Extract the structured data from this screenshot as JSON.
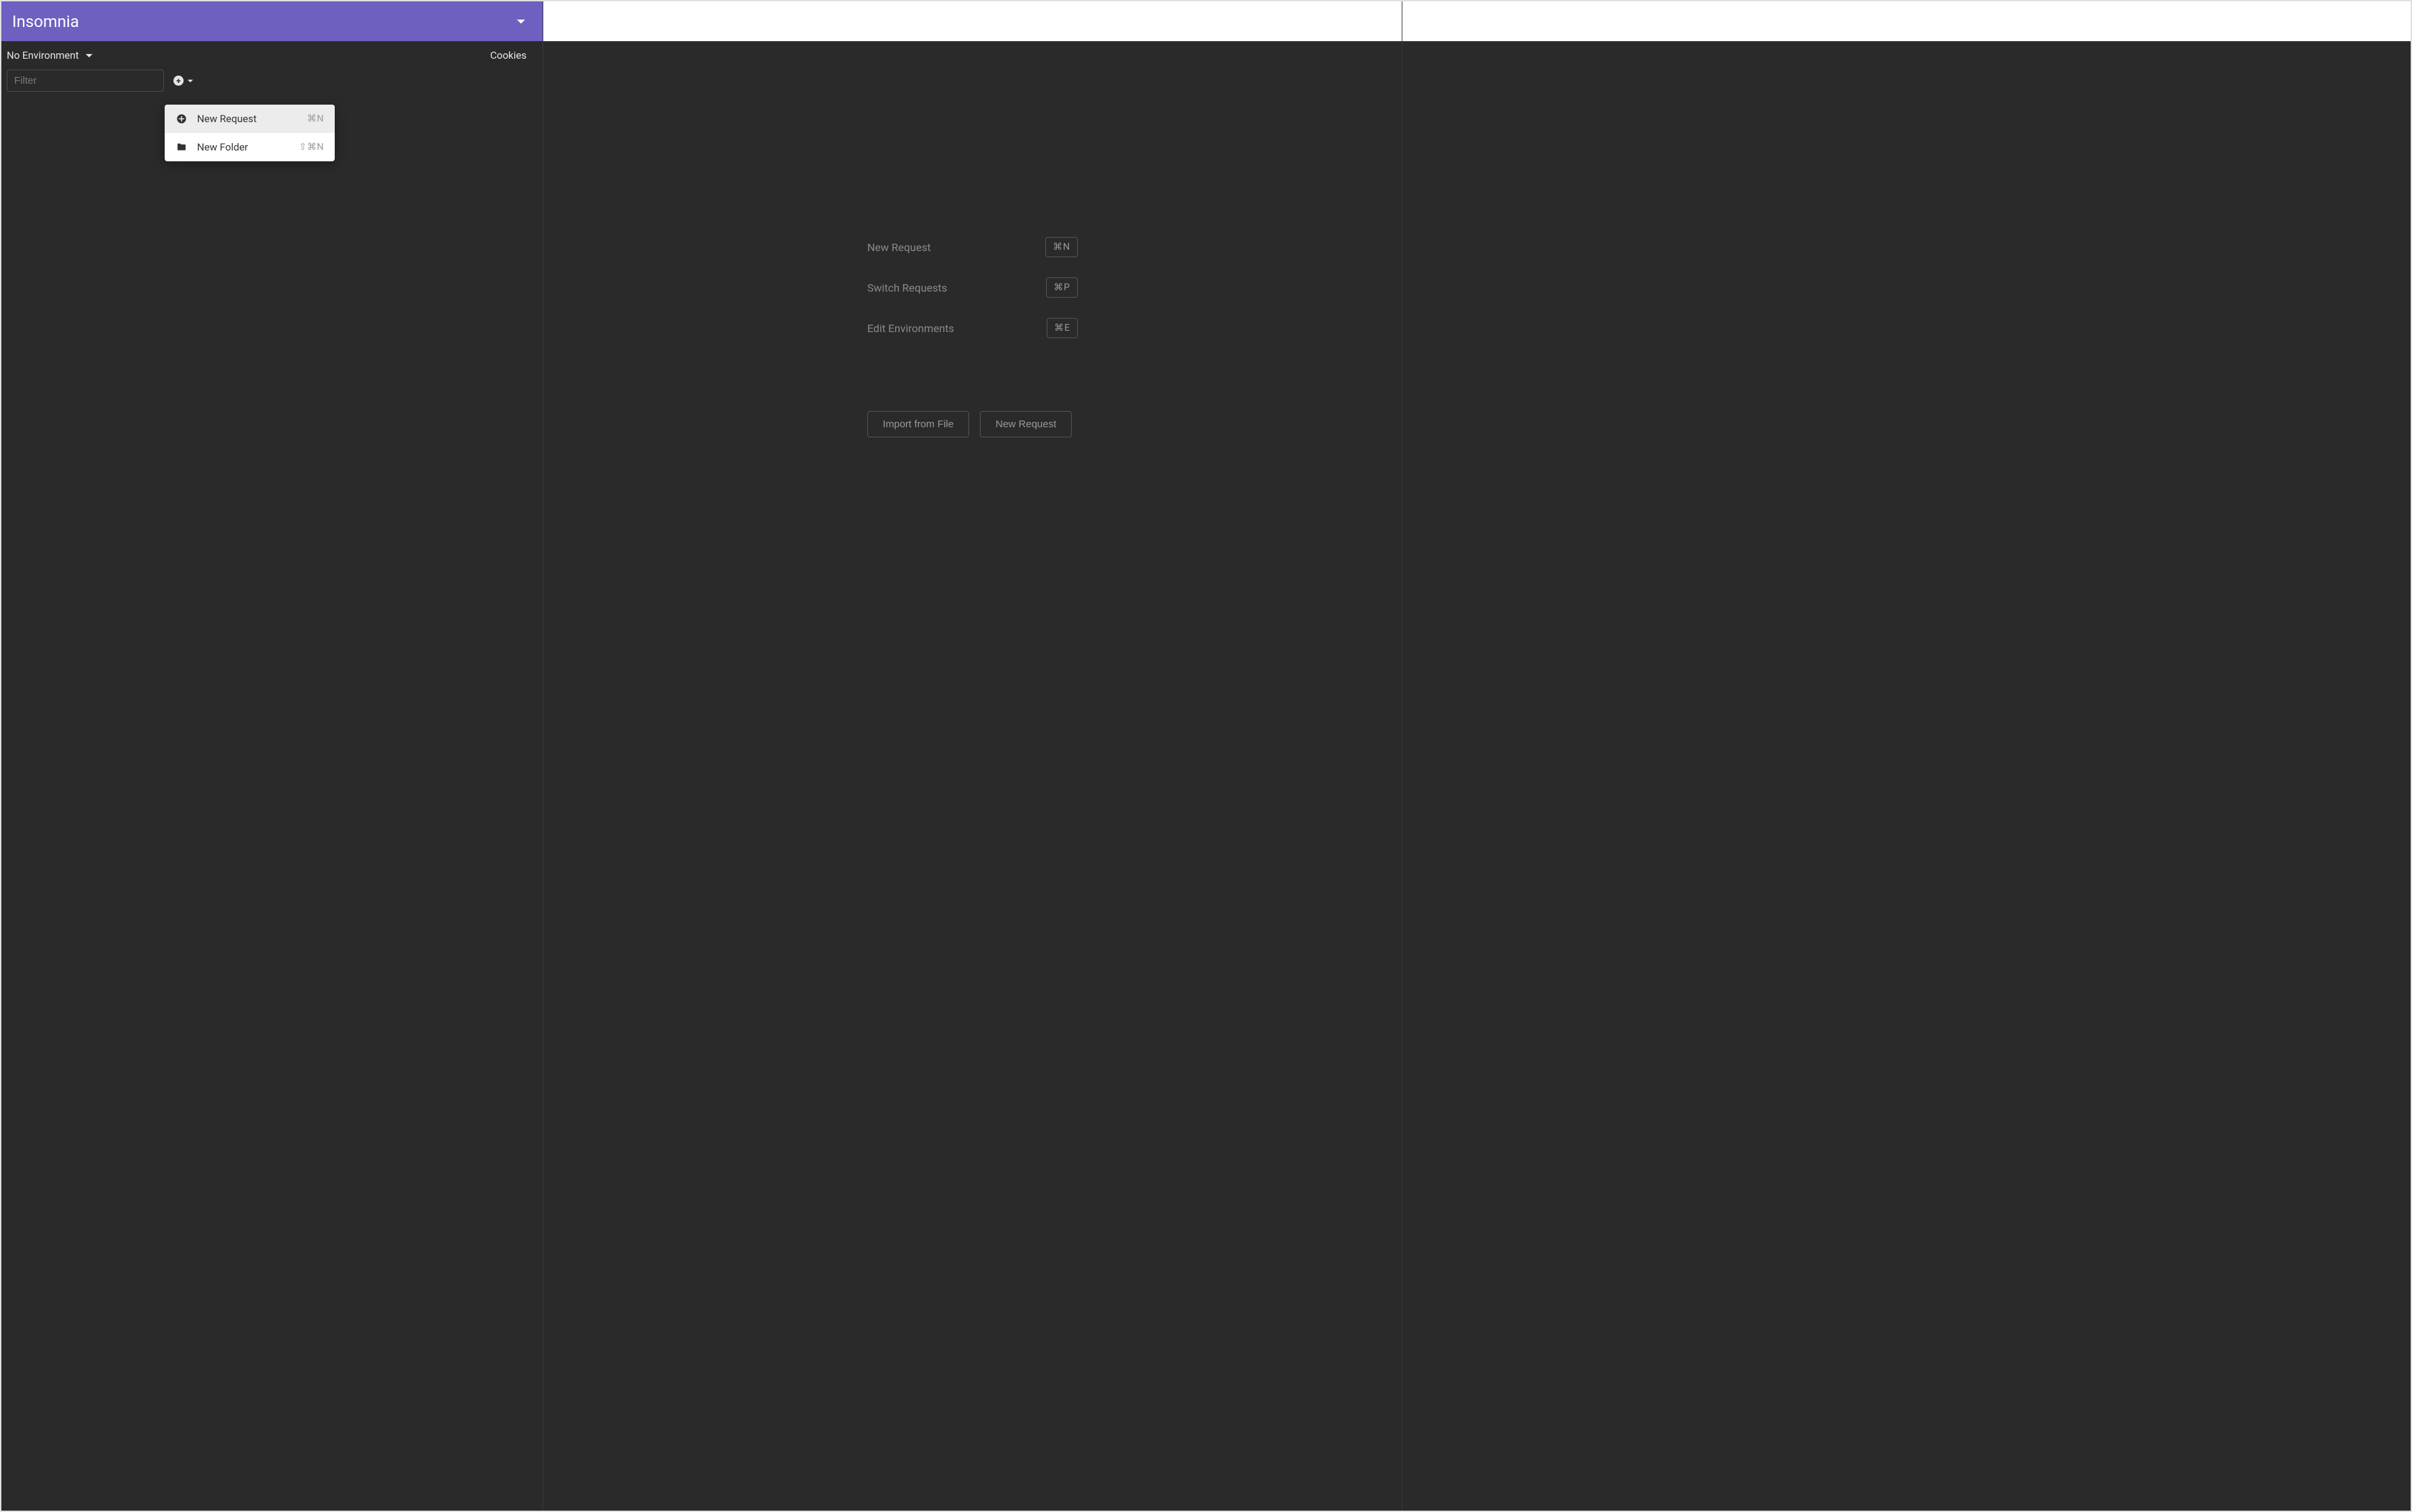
{
  "workspace": {
    "title": "Insomnia"
  },
  "environment": {
    "label": "No Environment",
    "cookies_label": "Cookies"
  },
  "filter": {
    "placeholder": "Filter",
    "value": ""
  },
  "create_menu": {
    "items": [
      {
        "icon": "plus-circle-icon",
        "label": "New Request",
        "shortcut": "⌘N"
      },
      {
        "icon": "folder-icon",
        "label": "New Folder",
        "shortcut": "⇧⌘N"
      }
    ]
  },
  "hints": [
    {
      "label": "New Request",
      "shortcut": "⌘N"
    },
    {
      "label": "Switch Requests",
      "shortcut": "⌘P"
    },
    {
      "label": "Edit Environments",
      "shortcut": "⌘E"
    }
  ],
  "actions": {
    "import_label": "Import from File",
    "new_request_label": "New Request"
  }
}
